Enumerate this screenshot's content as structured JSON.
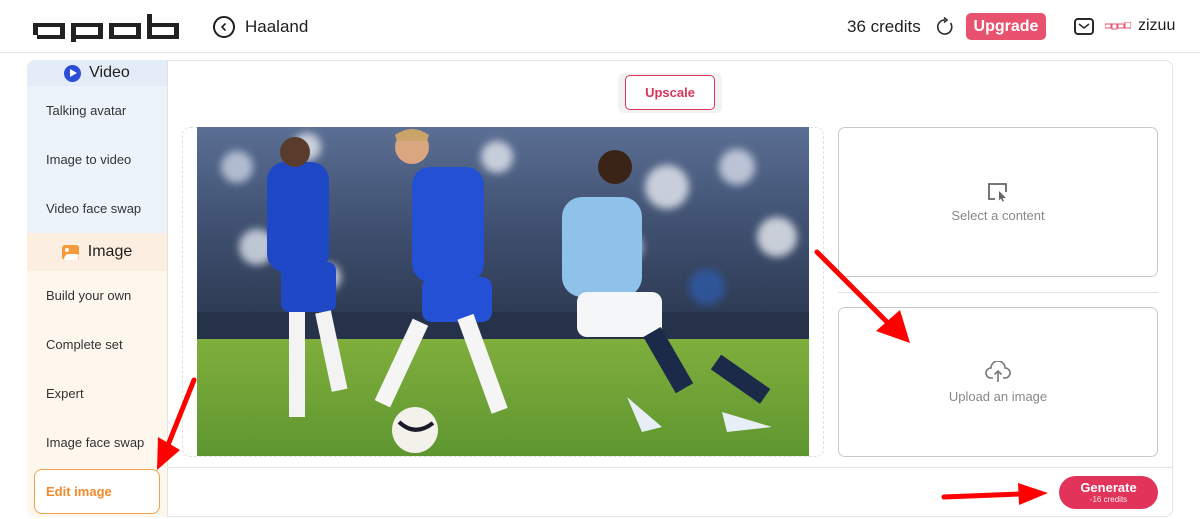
{
  "header": {
    "logo_text": "apob",
    "project_title": "Haaland",
    "credits": "36 credits",
    "upgrade_label": "Upgrade",
    "username": "zizuu",
    "icons": [
      "back-icon",
      "refresh-icon",
      "mail-icon"
    ]
  },
  "sidebar": {
    "sections": [
      {
        "title": "Video",
        "icon": "play-icon",
        "accent": "#2a4fd6",
        "items": [
          "Talking avatar",
          "Image to video",
          "Video face swap"
        ]
      },
      {
        "title": "Image",
        "icon": "image-icon",
        "accent": "#f59a3a",
        "items": [
          "Build your own",
          "Complete set",
          "Expert",
          "Image face swap",
          "Edit image"
        ]
      }
    ],
    "active_item": "Edit image"
  },
  "main": {
    "upscale_label": "Upscale",
    "photo_alt": "Football match: players in blue kits and a player in a light blue kit on the pitch",
    "select_content_label": "Select a content",
    "upload_label": "Upload an image",
    "generate_label": "Generate",
    "generate_cost": "-16 credits"
  },
  "colors": {
    "brand_pink": "#e2335b",
    "upgrade": "#e8526e",
    "active_orange": "#f08a2a",
    "annotation_red": "#ff0000"
  }
}
